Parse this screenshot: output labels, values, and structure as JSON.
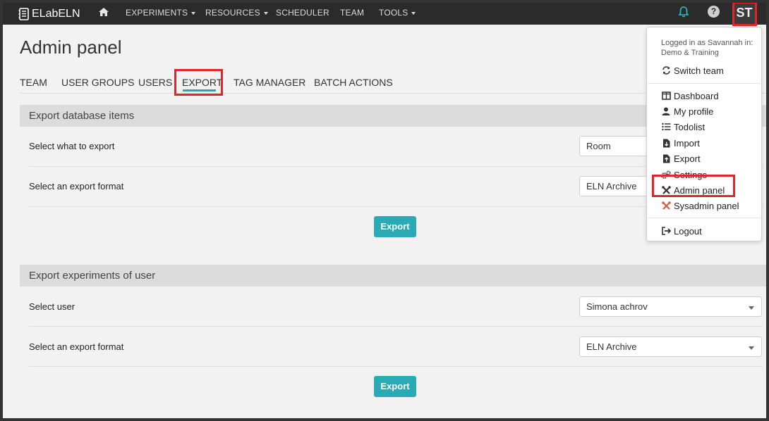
{
  "brand": {
    "name": "ELabELN",
    "icon": "notebook-icon"
  },
  "nav": {
    "home_icon": "home-icon",
    "items": [
      {
        "label": "EXPERIMENTS",
        "dropdown": true
      },
      {
        "label": "RESOURCES",
        "dropdown": true
      },
      {
        "label": "SCHEDULER",
        "dropdown": false
      },
      {
        "label": "TEAM",
        "dropdown": false
      },
      {
        "label": "TOOLS",
        "dropdown": true
      }
    ],
    "bell_icon": "bell-icon",
    "help_label": "?",
    "avatar_initials": "ST"
  },
  "page": {
    "title": "Admin panel",
    "tabs": [
      {
        "label": "TEAM"
      },
      {
        "label": "USER GROUPS"
      },
      {
        "label": "USERS"
      },
      {
        "label": "EXPORT"
      },
      {
        "label": "TAG MANAGER"
      },
      {
        "label": "BATCH ACTIONS"
      }
    ],
    "active_tab": "EXPORT"
  },
  "export_db": {
    "heading": "Export database items",
    "what_label": "Select what to export",
    "what_value": "Room",
    "format_label": "Select an export format",
    "format_value": "ELN Archive",
    "button": "Export"
  },
  "export_exp": {
    "heading": "Export experiments of user",
    "user_label": "Select user",
    "user_value": "Simona achrov",
    "format_label": "Select an export format",
    "format_value": "ELN Archive",
    "button": "Export"
  },
  "menu": {
    "logged_in_line1": "Logged in as Savannah in:",
    "logged_in_line2": "Demo & Training",
    "switch_team": "Switch team",
    "dashboard": "Dashboard",
    "my_profile": "My profile",
    "todolist": "Todolist",
    "import": "Import",
    "export": "Export",
    "settings": "Settings",
    "admin_panel": "Admin panel",
    "sysadmin_panel": "Sysadmin panel",
    "logout": "Logout"
  },
  "colors": {
    "navbar": "#2b2b2b",
    "accent": "#29aab5",
    "highlight": "#e0262d",
    "sysadmin_icon": "#e05a3a"
  }
}
